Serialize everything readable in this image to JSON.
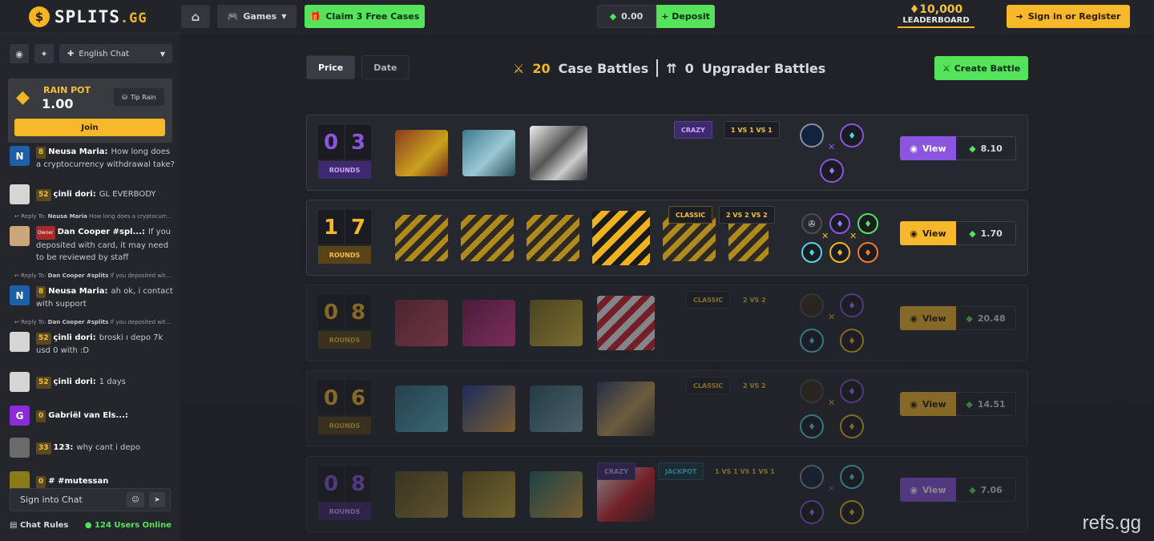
{
  "topbar": {
    "logo_coin": "$",
    "logo_name": "SPLITS",
    "logo_tld": ".GG",
    "games_label": "Games",
    "claim_label": "Claim 3 Free Cases",
    "balance": "0.00",
    "deposit_label": "Deposit",
    "leaderboard_amount": "10,000",
    "leaderboard_label": "LEADERBOARD",
    "signin_label": "Sign in or Register"
  },
  "sidebar": {
    "language": "English Chat",
    "rain_title": "RAIN POT",
    "rain_value": "1.00",
    "tip_label": "Tip Rain",
    "join_label": "Join",
    "chat_placeholder": "Sign into Chat",
    "rules_label": "Chat Rules",
    "online_label": "124 Users Online",
    "messages": [
      {
        "initial": "N",
        "level": "8",
        "user": "Neusa Maria:",
        "text": "How long does a cryptocurrency withdrawal take?",
        "color": "#1d5fa8"
      },
      {
        "initial": "",
        "level": "52",
        "user": "çinli dori:",
        "text": "GL EVERBODY",
        "color": "#cfcfcf"
      },
      {
        "reply_user": "Neusa Maria",
        "reply_text": "How long does a cryptocurr..."
      },
      {
        "initial": "",
        "level": "Owner",
        "user": "Dan Cooper #spl...:",
        "text": "If you deposited with card, it may need to be reviewed by staff",
        "color": "#c9a77a"
      },
      {
        "reply_user": "Dan Cooper #splits",
        "reply_text": "If you deposited wit..."
      },
      {
        "initial": "N",
        "level": "8",
        "user": "Neusa Maria:",
        "text": "ah ok, i contact with support",
        "color": "#1d5fa8"
      },
      {
        "reply_user": "Dan Cooper #splits",
        "reply_text": "If you deposited wit..."
      },
      {
        "initial": "",
        "level": "52",
        "user": "çinli dori:",
        "text": "broski ı depo 7k usd 0 with :D",
        "color": "#cfcfcf"
      },
      {
        "initial": "",
        "level": "52",
        "user": "çinli dori:",
        "text": "1 days",
        "color": "#cfcfcf"
      },
      {
        "initial": "G",
        "level": "0",
        "user": "Gabriël van Els...:",
        "text": "",
        "color": "#8a2bd6"
      },
      {
        "initial": "",
        "level": "33",
        "user": "123:",
        "text": "why cant i depo",
        "color": "#6b6b6b"
      },
      {
        "initial": "",
        "level": "0",
        "user": "# #mutessan",
        "text": "",
        "color": "#8a7a1a"
      }
    ]
  },
  "main": {
    "tab_price": "Price",
    "tab_date": "Date",
    "case_count": "20",
    "case_label": "Case Battles",
    "upgrader_count": "0",
    "upgrader_label": "Upgrader Battles",
    "create_label": "Create Battle",
    "rounds_label": "ROUNDS",
    "view_label": "View",
    "battles": [
      {
        "d1": "0",
        "d2": "3",
        "mode": "CRAZY",
        "format": "1 VS 1 VS 1",
        "price": "8.10",
        "accent": "#8c55e0"
      },
      {
        "d1": "1",
        "d2": "7",
        "mode": "CLASSIC",
        "format": "2 VS 2 VS 2",
        "price": "1.70",
        "accent": "#f6b72a"
      },
      {
        "d1": "0",
        "d2": "8",
        "mode": "CLASSIC",
        "format": "2 VS 2",
        "price": "20.48",
        "accent": "#f6b72a"
      },
      {
        "d1": "0",
        "d2": "6",
        "mode": "CLASSIC",
        "format": "2 VS 2",
        "price": "14.51",
        "accent": "#f6b72a"
      },
      {
        "d1": "0",
        "d2": "8",
        "mode": "CRAZY",
        "mode2": "JACKPOT",
        "format": "1 VS 1 VS 1 VS 1",
        "price": "7.06",
        "accent": "#8c55e0"
      }
    ]
  },
  "watermark": "refs.gg",
  "colors": {
    "green": "#54e35a",
    "gold": "#f6b72a",
    "purple": "#8c55e0"
  }
}
